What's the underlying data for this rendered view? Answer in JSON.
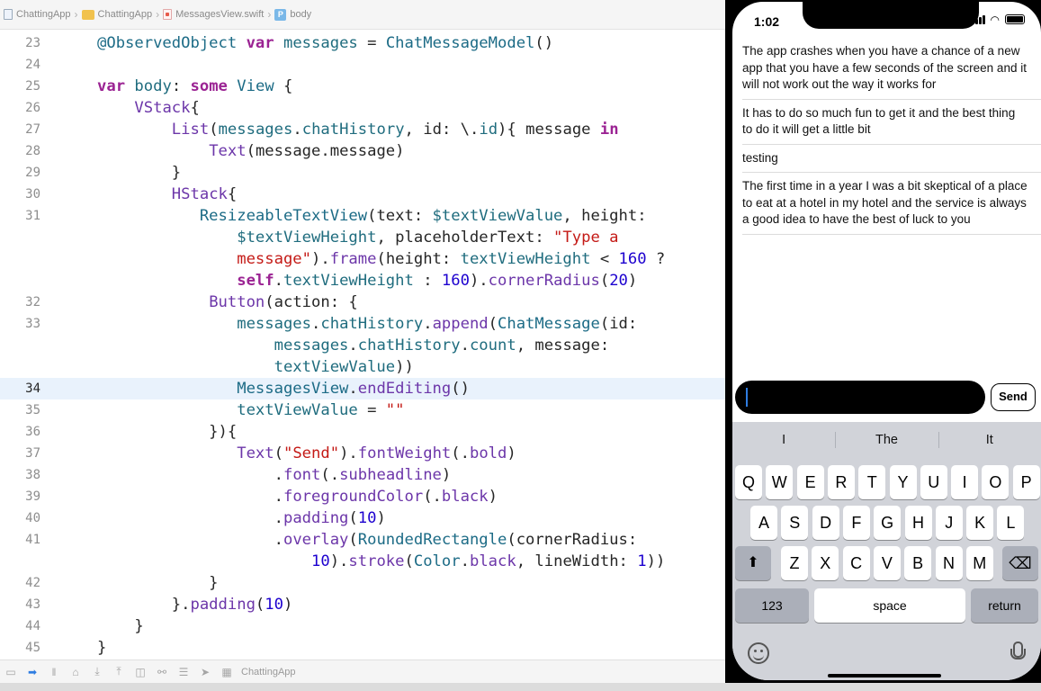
{
  "breadcrumb": {
    "items": [
      "ChattingApp",
      "ChattingApp",
      "MessagesView.swift",
      "body"
    ]
  },
  "code": {
    "current_line": "34",
    "lines": [
      {
        "n": "23",
        "html": "<span class=\"at\">@ObservedObject</span> <span class=\"kw\">var</span> <span class=\"pr\">messages</span> = <span class=\"ty\">ChatMessageModel</span>()"
      },
      {
        "n": "24",
        "html": ""
      },
      {
        "n": "25",
        "html": "<span class=\"kw\">var</span> <span class=\"pr\">body</span>: <span class=\"kw\">some</span> <span class=\"ty\">View</span> {"
      },
      {
        "n": "26",
        "html": "    <span class=\"fn\">VStack</span>{"
      },
      {
        "n": "27",
        "html": "        <span class=\"fn\">List</span>(<span class=\"pr\">messages</span>.<span class=\"pr\">chatHistory</span>, id: \\.<span class=\"pr\">id</span>){ message <span class=\"kw\">in</span>"
      },
      {
        "n": "28",
        "html": "            <span class=\"fn\">Text</span>(message.message)"
      },
      {
        "n": "29",
        "html": "        }"
      },
      {
        "n": "30",
        "html": "        <span class=\"fn\">HStack</span>{"
      },
      {
        "n": "31",
        "html": "           <span class=\"ty\">ResizeableTextView</span>(text: <span class=\"pr\">$textViewValue</span>, height:"
      },
      {
        "n": "",
        "html": "               <span class=\"pr\">$textViewHeight</span>, placeholderText: <span class=\"st\">\"Type a</span>"
      },
      {
        "n": "",
        "html": "               <span class=\"st\">message\"</span>).<span class=\"fn\">frame</span>(height: <span class=\"pr\">textViewHeight</span> &lt; <span class=\"nm\">160</span> ?"
      },
      {
        "n": "",
        "html": "               <span class=\"kw\">self</span>.<span class=\"pr\">textViewHeight</span> : <span class=\"nm\">160</span>).<span class=\"fn\">cornerRadius</span>(<span class=\"nm\">20</span>)"
      },
      {
        "n": "32",
        "html": "            <span class=\"fn\">Button</span>(action: {"
      },
      {
        "n": "33",
        "html": "               <span class=\"pr\">messages</span>.<span class=\"pr\">chatHistory</span>.<span class=\"fn\">append</span>(<span class=\"ty\">ChatMessage</span>(id:"
      },
      {
        "n": "",
        "html": "                   <span class=\"pr\">messages</span>.<span class=\"pr\">chatHistory</span>.<span class=\"pr\">count</span>, message:"
      },
      {
        "n": "",
        "html": "                   <span class=\"pr\">textViewValue</span>))"
      },
      {
        "n": "34",
        "html": "               <span class=\"ty\">MessagesView</span>.<span class=\"fn\">endEditing</span>()"
      },
      {
        "n": "35",
        "html": "               <span class=\"pr\">textViewValue</span> = <span class=\"st\">\"\"</span>"
      },
      {
        "n": "36",
        "html": "            }){"
      },
      {
        "n": "37",
        "html": "               <span class=\"fn\">Text</span>(<span class=\"st\">\"Send\"</span>).<span class=\"fn\">fontWeight</span>(.<span class=\"fn\">bold</span>)"
      },
      {
        "n": "38",
        "html": "                   .<span class=\"fn\">font</span>(.<span class=\"fn\">subheadline</span>)"
      },
      {
        "n": "39",
        "html": "                   .<span class=\"fn\">foregroundColor</span>(.<span class=\"fn\">black</span>)"
      },
      {
        "n": "40",
        "html": "                   .<span class=\"fn\">padding</span>(<span class=\"nm\">10</span>)"
      },
      {
        "n": "41",
        "html": "                   .<span class=\"fn\">overlay</span>(<span class=\"ty\">RoundedRectangle</span>(cornerRadius:"
      },
      {
        "n": "",
        "html": "                       <span class=\"nm\">10</span>).<span class=\"fn\">stroke</span>(<span class=\"ty\">Color</span>.<span class=\"fn\">black</span>, lineWidth: <span class=\"nm\">1</span>))"
      },
      {
        "n": "42",
        "html": "            }"
      },
      {
        "n": "43",
        "html": "        }.<span class=\"fn\">padding</span>(<span class=\"nm\">10</span>)"
      },
      {
        "n": "44",
        "html": "    }"
      },
      {
        "n": "45",
        "html": "}"
      }
    ]
  },
  "debugbar": {
    "scheme": "ChattingApp"
  },
  "phone": {
    "time": "1:02",
    "messages": [
      "The app crashes when you have a chance of a new app that you have a few seconds of the screen and it will not work out the way it works for",
      "It has to do so much fun to get it and the best thing to do it will get a little bit",
      "testing",
      "The first time in a year I was a bit skeptical of a place to eat at a hotel in my hotel and the service is always a good idea to have the best of luck to you"
    ],
    "send_label": "Send",
    "suggestions": [
      "I",
      "The",
      "It"
    ],
    "keyboard": {
      "row1": [
        "Q",
        "W",
        "E",
        "R",
        "T",
        "Y",
        "U",
        "I",
        "O",
        "P"
      ],
      "row2": [
        "A",
        "S",
        "D",
        "F",
        "G",
        "H",
        "J",
        "K",
        "L"
      ],
      "row3": [
        "Z",
        "X",
        "C",
        "V",
        "B",
        "N",
        "M"
      ],
      "numbers_label": "123",
      "space_label": "space",
      "return_label": "return"
    }
  }
}
